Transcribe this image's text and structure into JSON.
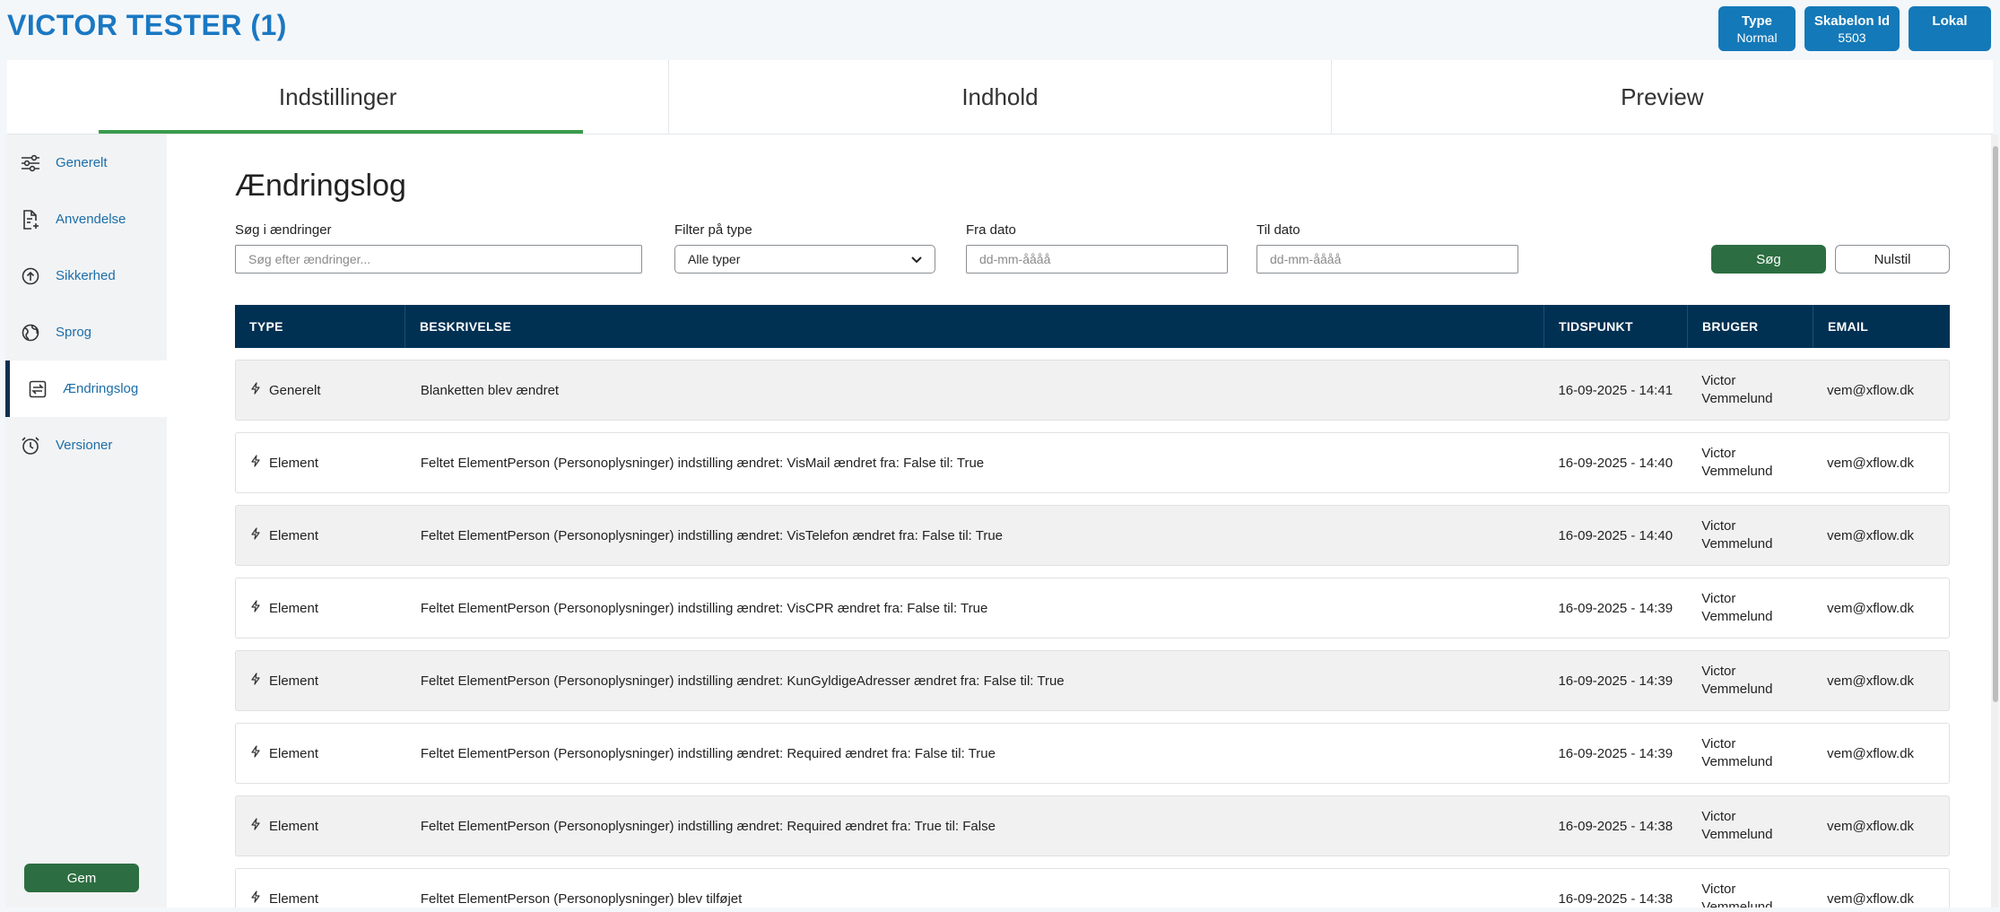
{
  "header": {
    "title": "VICTOR TESTER (1)",
    "badges": [
      {
        "title": "Type",
        "value": "Normal"
      },
      {
        "title": "Skabelon Id",
        "value": "5503"
      },
      {
        "title": "Lokal",
        "value": ""
      }
    ]
  },
  "tabs": [
    {
      "label": "Indstillinger",
      "active": true
    },
    {
      "label": "Indhold",
      "active": false
    },
    {
      "label": "Preview",
      "active": false
    }
  ],
  "sidebar": {
    "items": [
      {
        "label": "Generelt",
        "icon": "sliders-icon"
      },
      {
        "label": "Anvendelse",
        "icon": "file-add-icon"
      },
      {
        "label": "Sikkerhed",
        "icon": "shield-arrow-icon"
      },
      {
        "label": "Sprog",
        "icon": "globe-icon"
      },
      {
        "label": "Ændringslog",
        "icon": "swap-icon",
        "active": true
      },
      {
        "label": "Versioner",
        "icon": "alarm-clock-icon"
      }
    ],
    "save_label": "Gem"
  },
  "main": {
    "title": "Ændringslog",
    "filters": {
      "search_label": "Søg i ændringer",
      "search_placeholder": "Søg efter ændringer...",
      "type_label": "Filter på type",
      "type_value": "Alle typer",
      "from_label": "Fra dato",
      "from_placeholder": "dd-mm-åååå",
      "to_label": "Til dato",
      "to_placeholder": "dd-mm-åååå",
      "search_button": "Søg",
      "reset_button": "Nulstil"
    },
    "table": {
      "headers": [
        "TYPE",
        "BESKRIVELSE",
        "TIDSPUNKT",
        "BRUGER",
        "EMAIL"
      ],
      "rows": [
        {
          "type": "Generelt",
          "desc": "Blanketten blev ændret",
          "time": "16-09-2025 - 14:41",
          "user_first": "Victor",
          "user_last": "Vemmelund",
          "email": "vem@xflow.dk"
        },
        {
          "type": "Element",
          "desc": "Feltet ElementPerson (Personoplysninger) indstilling ændret: VisMail ændret fra: False til: True",
          "time": "16-09-2025 - 14:40",
          "user_first": "Victor",
          "user_last": "Vemmelund",
          "email": "vem@xflow.dk"
        },
        {
          "type": "Element",
          "desc": "Feltet ElementPerson (Personoplysninger) indstilling ændret: VisTelefon ændret fra: False til: True",
          "time": "16-09-2025 - 14:40",
          "user_first": "Victor",
          "user_last": "Vemmelund",
          "email": "vem@xflow.dk"
        },
        {
          "type": "Element",
          "desc": "Feltet ElementPerson (Personoplysninger) indstilling ændret: VisCPR ændret fra: False til: True",
          "time": "16-09-2025 - 14:39",
          "user_first": "Victor",
          "user_last": "Vemmelund",
          "email": "vem@xflow.dk"
        },
        {
          "type": "Element",
          "desc": "Feltet ElementPerson (Personoplysninger) indstilling ændret: KunGyldigeAdresser ændret fra: False til: True",
          "time": "16-09-2025 - 14:39",
          "user_first": "Victor",
          "user_last": "Vemmelund",
          "email": "vem@xflow.dk"
        },
        {
          "type": "Element",
          "desc": "Feltet ElementPerson (Personoplysninger) indstilling ændret: Required ændret fra: False til: True",
          "time": "16-09-2025 - 14:39",
          "user_first": "Victor",
          "user_last": "Vemmelund",
          "email": "vem@xflow.dk"
        },
        {
          "type": "Element",
          "desc": "Feltet ElementPerson (Personoplysninger) indstilling ændret: Required ændret fra: True til: False",
          "time": "16-09-2025 - 14:38",
          "user_first": "Victor",
          "user_last": "Vemmelund",
          "email": "vem@xflow.dk"
        },
        {
          "type": "Element",
          "desc": "Feltet ElementPerson (Personoplysninger) blev tilføjet",
          "time": "16-09-2025 - 14:38",
          "user_first": "Victor",
          "user_last": "Vemmelund",
          "email": "vem@xflow.dk"
        }
      ]
    }
  },
  "colors": {
    "brand_blue": "#1a78c2",
    "badge_blue": "#1479b8",
    "table_header": "#003153",
    "primary_green": "#2c6e41",
    "tab_underline": "#3a9b4d"
  }
}
